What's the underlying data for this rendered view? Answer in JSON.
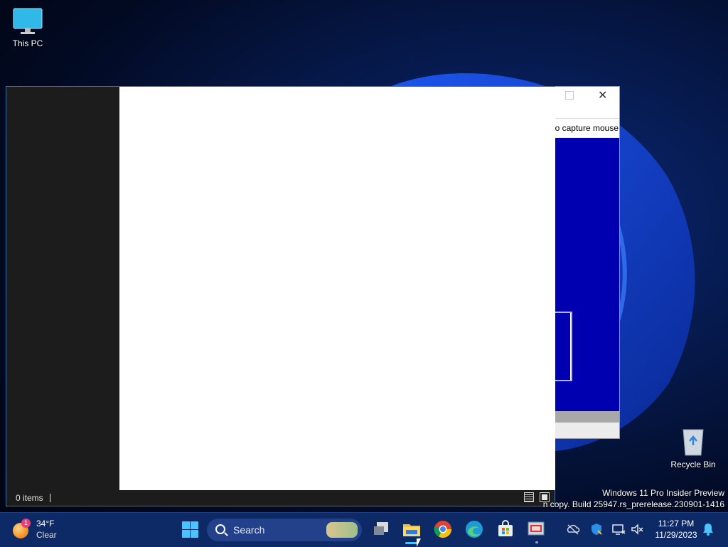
{
  "desktop": {
    "icons": [
      {
        "label": "This PC",
        "icon": "computer-icon"
      },
      {
        "label": "Recycle Bin",
        "icon": "recycle-bin-icon"
      }
    ],
    "watermark": {
      "line1": "Windows 11 Pro Insider Preview",
      "line2": "n copy. Build 25947.rs_prerelease.230901-1416"
    }
  },
  "background_window": {
    "hint_text": "o capture mouse",
    "close_glyph": "✕"
  },
  "explorer": {
    "status": {
      "item_count": "0 items"
    }
  },
  "taskbar": {
    "weather": {
      "badge": "1",
      "temperature": "34°F",
      "condition": "Clear"
    },
    "search": {
      "label": "Search"
    },
    "apps": [
      {
        "name": "task-view",
        "icon": "task-view-icon"
      },
      {
        "name": "file-explorer",
        "icon": "folder-icon",
        "active": true
      },
      {
        "name": "chrome",
        "icon": "chrome-icon"
      },
      {
        "name": "edge",
        "icon": "edge-icon"
      },
      {
        "name": "store",
        "icon": "store-icon"
      },
      {
        "name": "vm-app",
        "icon": "vm-app-icon"
      }
    ],
    "clock": {
      "time": "11:27 PM",
      "date": "11/29/2023"
    }
  },
  "colors": {
    "accent": "#4cc2ff",
    "taskbar": "#0e2a66",
    "explorer_dark": "#1c1c1c",
    "vm_blue": "#0000b0"
  }
}
